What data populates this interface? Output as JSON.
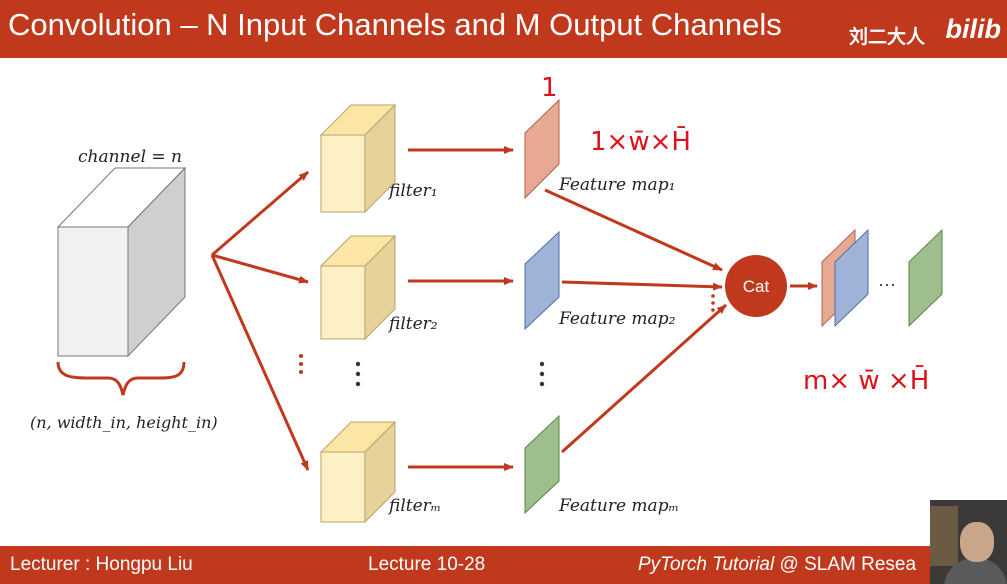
{
  "header": {
    "title": "Convolution – N Input Channels and M Output Channels",
    "watermark": "刘二大人",
    "logo": "bilib"
  },
  "diagram": {
    "input_label_top": "channel = n",
    "input_label_bottom": "(n, width_in, height_in)",
    "filter_labels": [
      "filter₁",
      "filter₂",
      "filterₘ"
    ],
    "feature_labels": [
      "Feature map₁",
      "Feature map₂",
      "Feature mapₘ"
    ],
    "cat_label": "Cat",
    "ellipsis": "···",
    "annotations": {
      "one": "1",
      "one_dims": "1×w̄×H̄",
      "m_dims": "m× w̄ ×H̄"
    },
    "colors": {
      "arrow": "#c0391d",
      "filter_front": "#fdf0c4",
      "filter_top": "#fbe6a6",
      "filter_side": "#e6d29b",
      "map1": "#e8a992",
      "map2": "#9fb3d8",
      "mapm": "#9fbe8e",
      "annotation_ink": "#e0101a"
    }
  },
  "footer": {
    "lecturer": "Lecturer : Hongpu Liu",
    "lecture": "Lecture 10-28",
    "course_italic": "PyTorch Tutorial",
    "course_rest": " @ SLAM Resea"
  }
}
